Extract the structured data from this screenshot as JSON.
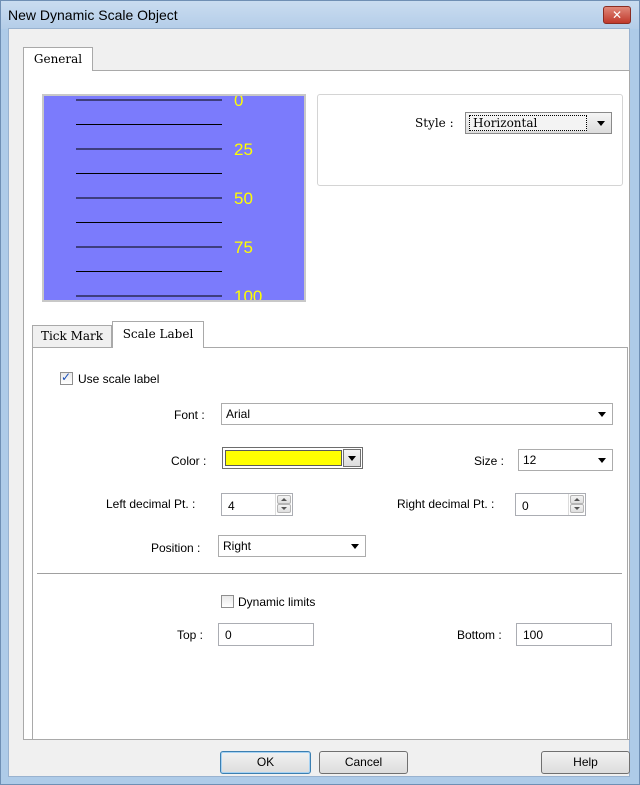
{
  "window": {
    "title": "New Dynamic Scale Object",
    "close_symbol": "✕"
  },
  "tabs": {
    "general": "General",
    "tick_mark": "Tick Mark",
    "scale_label": "Scale Label"
  },
  "preview": {
    "background_color": "#7b7bfc",
    "label_color": "#ffff00",
    "scale_labels": [
      "0",
      "25",
      "50",
      "75",
      "100"
    ]
  },
  "style": {
    "label": "Style :",
    "value": "Horizontal"
  },
  "scale_label": {
    "use_scale_label": {
      "label": "Use scale label",
      "checked": true
    },
    "font": {
      "label": "Font :",
      "value": "Arial"
    },
    "color": {
      "label": "Color :",
      "value_hex": "#ffff00"
    },
    "size": {
      "label": "Size :",
      "value": "12"
    },
    "left_decimal": {
      "label": "Left decimal Pt. :",
      "value": "4"
    },
    "right_decimal": {
      "label": "Right decimal Pt. :",
      "value": "0"
    },
    "position": {
      "label": "Position :",
      "value": "Right"
    },
    "dynamic_limits": {
      "label": "Dynamic limits",
      "checked": false
    },
    "top": {
      "label": "Top :",
      "value": "0"
    },
    "bottom": {
      "label": "Bottom :",
      "value": "100"
    }
  },
  "buttons": {
    "ok": "OK",
    "cancel": "Cancel",
    "help": "Help"
  }
}
